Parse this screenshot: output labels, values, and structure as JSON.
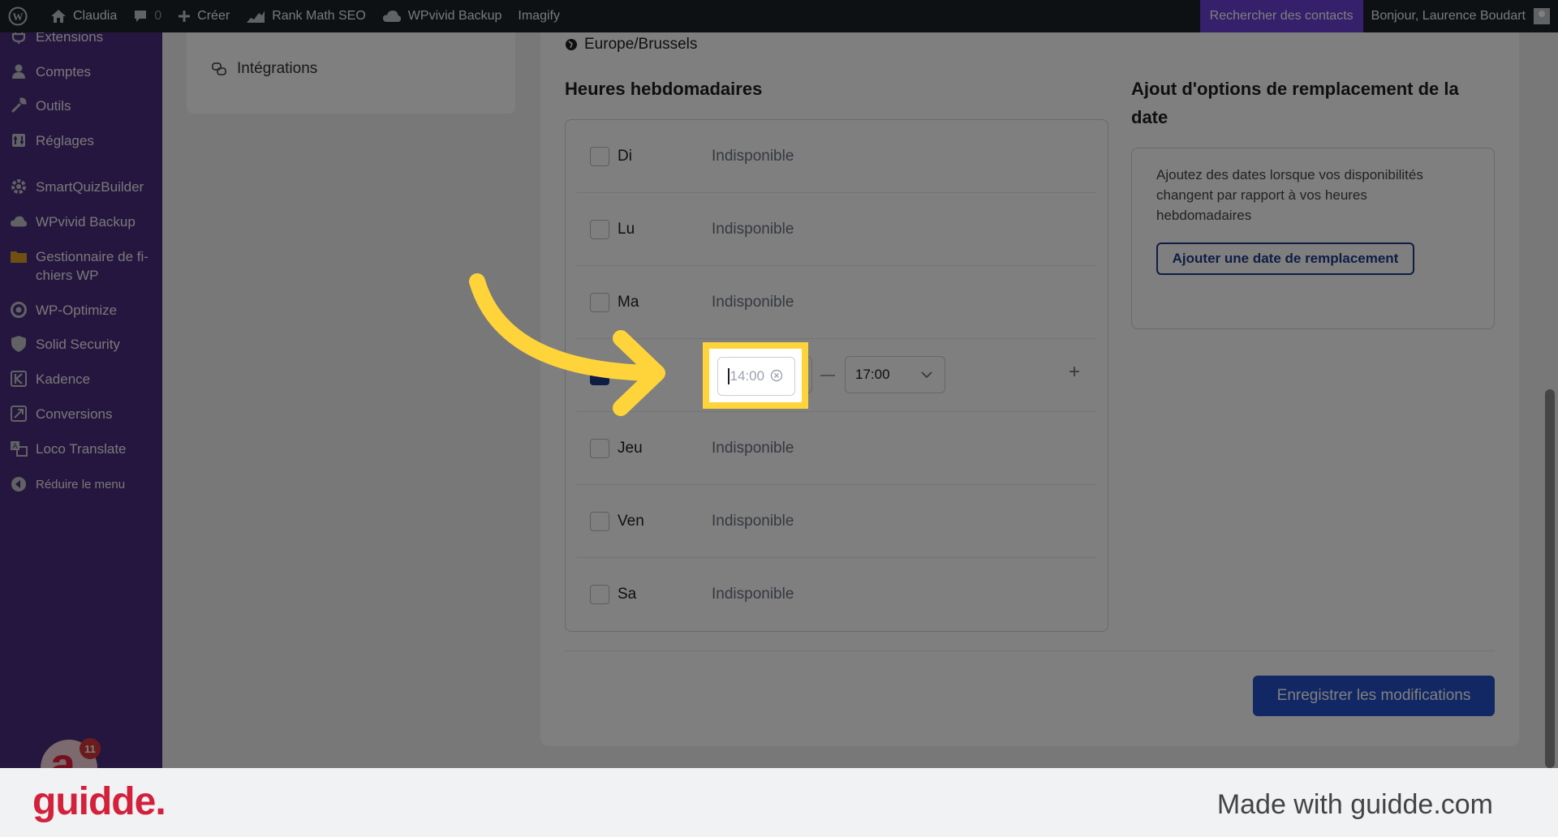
{
  "adminbar": {
    "site_name": "Claudia",
    "comments_count": "0",
    "create_label": "Créer",
    "rank_math": "Rank Math SEO",
    "wpvivid": "WPvivid Backup",
    "imagify": "Imagify",
    "search_contacts": "Rechercher des contacts",
    "greeting": "Bonjour, Laurence Boudart"
  },
  "sidebar": {
    "items": [
      {
        "label": "Extensions",
        "icon": "plugin-icon"
      },
      {
        "label": "Comptes",
        "icon": "user-icon"
      },
      {
        "label": "Outils",
        "icon": "wrench-icon"
      },
      {
        "label": "Réglages",
        "icon": "settings-icon"
      },
      {
        "label": "SmartQuizBuilder",
        "icon": "gear-icon"
      },
      {
        "label": "WPvivid Backup",
        "icon": "cloud-icon"
      },
      {
        "label": "Gestionnaire de fi-chiers WP",
        "icon": "folder-icon"
      },
      {
        "label": "WP-Optimize",
        "icon": "optimize-icon"
      },
      {
        "label": "Solid Security",
        "icon": "shield-icon"
      },
      {
        "label": "Kadence",
        "icon": "kadence-icon"
      },
      {
        "label": "Conversions",
        "icon": "conversions-icon"
      },
      {
        "label": "Loco Translate",
        "icon": "translate-icon"
      },
      {
        "label": "Réduire le menu",
        "icon": "collapse-icon"
      }
    ],
    "badge_count": "11",
    "badge_letter": "a"
  },
  "left_nav": {
    "integrations": "Intégrations"
  },
  "main": {
    "timezone": "Europe/Brussels",
    "weekly_hours_title": "Heures hebdomadaires",
    "overrides_title": "Ajout d'options de remplacement de la date",
    "overrides_desc": "Ajoutez des dates lorsque vos disponibilités changent par rapport à vos heures hebdomadaires",
    "add_override_button": "Ajouter une date de remplacement",
    "save_button": "Enregistrer les modifications",
    "days": [
      {
        "label": "Di",
        "status": "Indisponible",
        "checked": false
      },
      {
        "label": "Lu",
        "status": "Indisponible",
        "checked": false
      },
      {
        "label": "Ma",
        "status": "Indisponible",
        "checked": false
      },
      {
        "label": "",
        "status": "",
        "checked": true
      },
      {
        "label": "Jeu",
        "status": "Indisponible",
        "checked": false
      },
      {
        "label": "Ven",
        "status": "Indisponible",
        "checked": false
      },
      {
        "label": "Sa",
        "status": "Indisponible",
        "checked": false
      }
    ],
    "start_time_placeholder": "14:00",
    "end_time_value": "17:00",
    "add_slot": "+"
  },
  "footer": {
    "brand": "guidde.",
    "made_with": "Made with guidde.com"
  },
  "colors": {
    "sidebar": "#4b2d7f",
    "adminbar": "#1d2327",
    "accent": "#2550c8",
    "highlight": "#ffd43b",
    "brand": "#d3203b"
  }
}
